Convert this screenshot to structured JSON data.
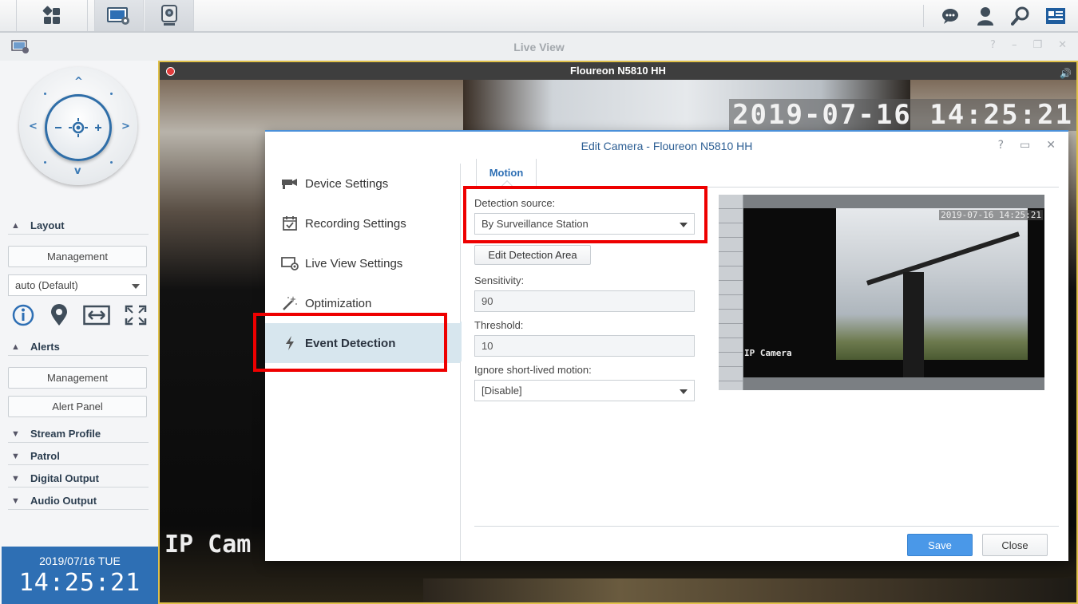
{
  "taskbar": {
    "buttons": [
      "main-menu",
      "surveillance-station",
      "ip-camera"
    ],
    "right_icons": [
      "chat-icon",
      "user-icon",
      "search-icon",
      "widget-icon"
    ]
  },
  "live_view": {
    "title": "Live View",
    "controls": [
      "?",
      "–",
      "❐",
      "✕"
    ]
  },
  "left_panel": {
    "layout_header": "Layout",
    "layout_management": "Management",
    "layout_select": "auto (Default)",
    "alerts_header": "Alerts",
    "alerts_management": "Management",
    "alert_panel": "Alert Panel",
    "sections": [
      "Stream Profile",
      "Patrol",
      "Digital Output",
      "Audio Output"
    ],
    "date": "2019/07/16  TUE",
    "time": "14:25:21"
  },
  "video": {
    "camera_title": "Floureon N5810 HH",
    "osd_timestamp": "2019-07-16 14:25:21",
    "osd_camera": "IP Cam"
  },
  "dialog": {
    "title": "Edit Camera - Floureon N5810 HH",
    "controls": [
      "?",
      "▭",
      "✕"
    ],
    "nav": [
      {
        "label": "Device Settings",
        "icon": "camera-icon"
      },
      {
        "label": "Recording Settings",
        "icon": "calendar-check-icon"
      },
      {
        "label": "Live View Settings",
        "icon": "monitor-camera-icon"
      },
      {
        "label": "Optimization",
        "icon": "magic-wand-icon"
      },
      {
        "label": "Event Detection",
        "icon": "lightning-icon",
        "selected": true
      }
    ],
    "tab": "Motion",
    "detection_source_label": "Detection source:",
    "detection_source_value": "By Surveillance Station",
    "edit_area_button": "Edit Detection Area",
    "sensitivity_label": "Sensitivity:",
    "sensitivity_value": "90",
    "threshold_label": "Threshold:",
    "threshold_value": "10",
    "ignore_label": "Ignore short-lived motion:",
    "ignore_value": "[Disable]",
    "preview_timestamp": "2019-07-16 14:25:21",
    "preview_camera": "IP Camera",
    "save": "Save",
    "close": "Close"
  },
  "colors": {
    "accent": "#2e6fb4",
    "highlight": "#e00000",
    "frame": "#e0c14b",
    "save_button": "#4a98e8"
  }
}
